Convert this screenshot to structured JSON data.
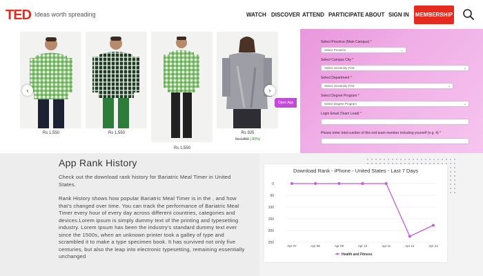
{
  "header": {
    "logo": "TED",
    "tagline": "Ideas worth spreading",
    "nav": [
      "WATCH",
      "DISCOVER",
      "ATTEND",
      "PARTICIPATE",
      "ABOUT",
      "SIGN IN"
    ],
    "membership": "MEMBERSHIP",
    "brand_color": "#e62b1e"
  },
  "products": [
    {
      "price": "Rs 1,550"
    },
    {
      "price": "Rs 1,550"
    },
    {
      "price": "Rs 1,550"
    },
    {
      "price": "Rs 925",
      "old_price": "Rs 1,850",
      "discount": "(-50%)"
    }
  ],
  "open_app": "Open App",
  "form": {
    "province_label": "Select Province (Main Campus)",
    "province_value": "Select Province",
    "city_label": "Select Campus City",
    "city_value": "Select University First",
    "department_label": "Select Department",
    "department_value": "Select University First",
    "degree_label": "Select Degree Program",
    "degree_value": "Select Degree Program",
    "email_label": "Login Email (Team Lead)",
    "members_label": "Please enter total number of this exit team member including yourself (e.g. 4)",
    "required_mark": "*"
  },
  "section": {
    "title": "App Rank History",
    "intro": "Check out the download rank history for Bariatric Meal Timer in United States.",
    "body": "Rank History shows how popular Bariatric Meal Timer is in the , and how that's changed over time. You can track the performance of Bariatric Meal Timer every hour of every day across different countries, categories and devices.Lorem ipsum is simply dummy text of the printing and typesetting industry. Lorem Ipsum has been the industry's standard dummy text ever since the 1500s, when an unknown printer took a galley of type and scrambled it to make a type specimen book. It has survived not only five centuries, but also the leap into electronic typesetting, remaining essentially unchanged"
  },
  "chart_data": {
    "type": "line",
    "title": "Download Rank - iPhone - United States - Last 7 Days",
    "categories": [
      "Apr 07",
      "Apr 08",
      "Apr 09",
      "Apr 10",
      "Apr 11",
      "Apr 12",
      "Apr 13"
    ],
    "series": [
      {
        "name": "Health and Fitness",
        "values": [
          0,
          0,
          0,
          0,
          0,
          225,
          178
        ],
        "color": "#c65ad9"
      }
    ],
    "y_ticks": [
      "0",
      "50",
      "100",
      "150",
      "200",
      "250"
    ],
    "ylim": [
      0,
      250
    ],
    "y_inverted": true,
    "legend": "bottom"
  }
}
